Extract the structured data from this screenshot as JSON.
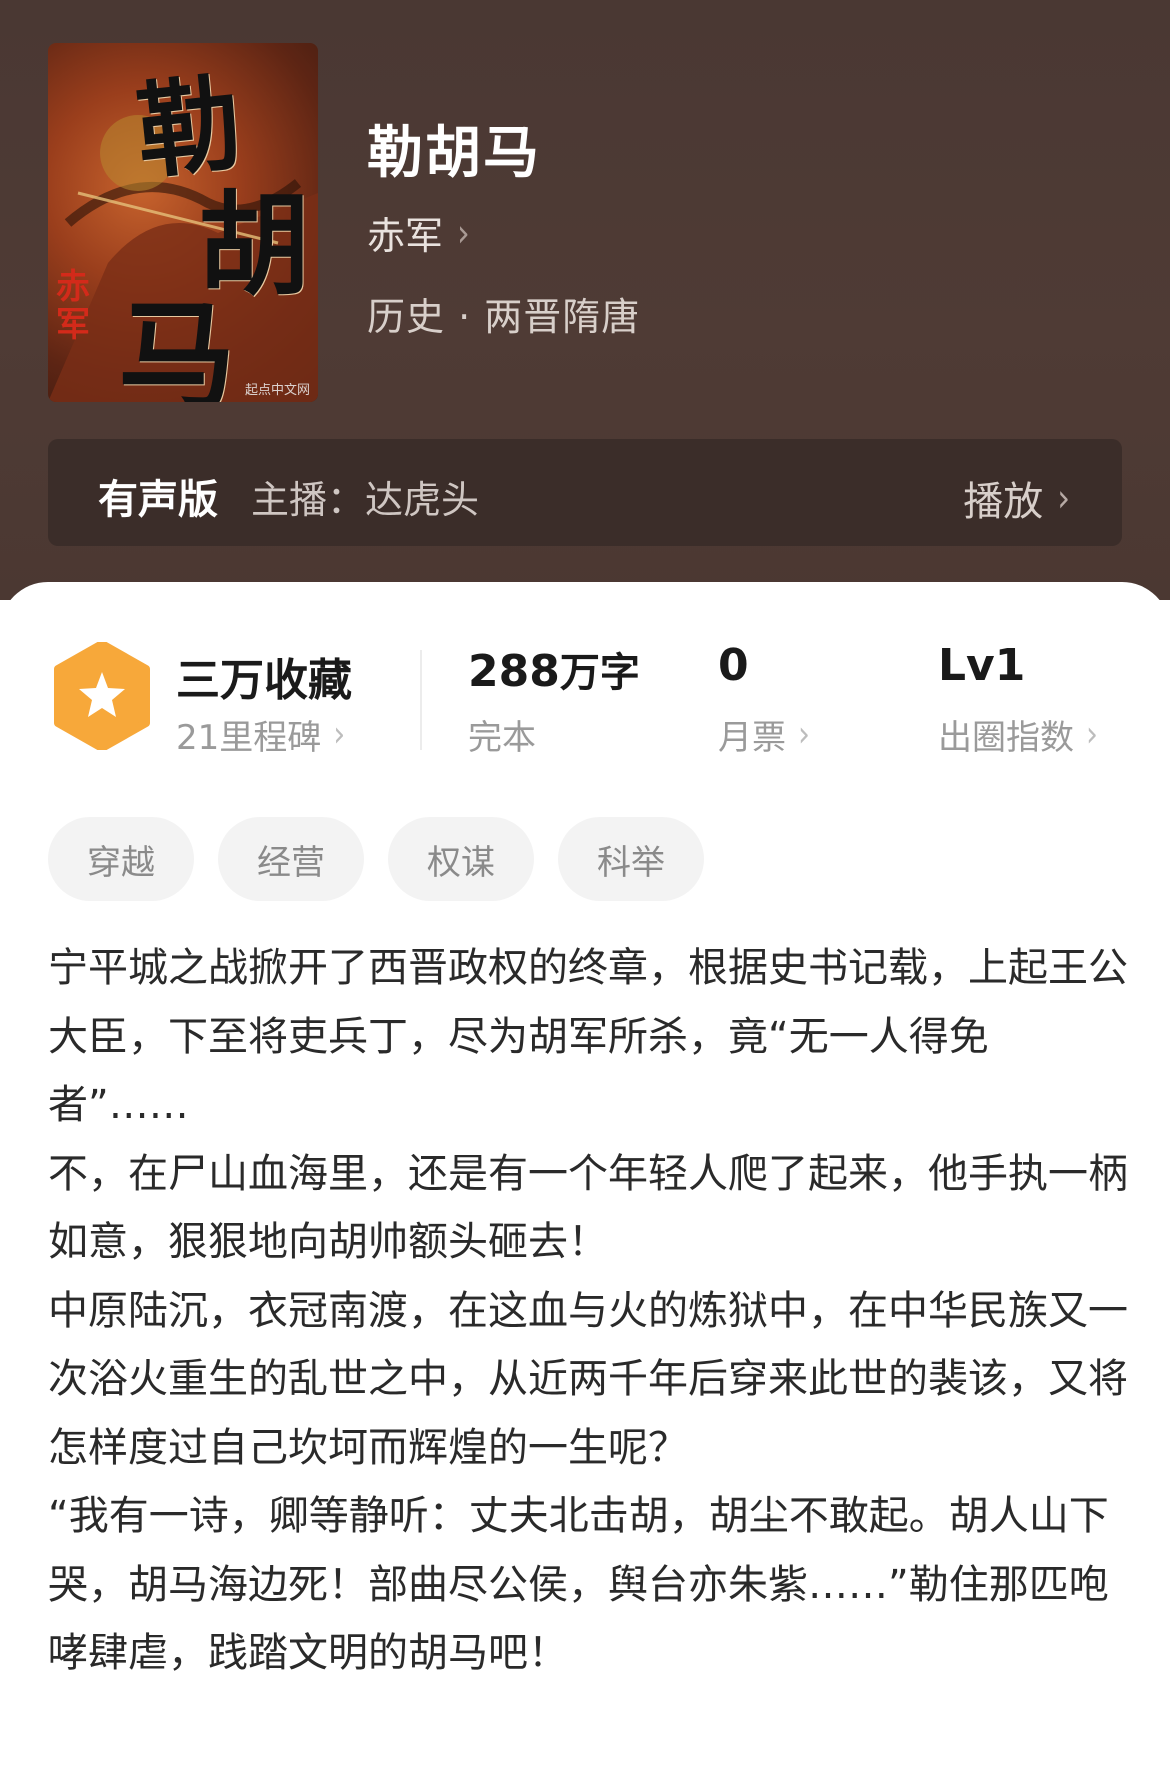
{
  "book": {
    "title": "勒胡马",
    "author": "赤军",
    "category": "历史 · 两晋隋唐",
    "cover": {
      "title_chars": [
        "勒",
        "胡",
        "马"
      ],
      "author_text": "赤军",
      "publisher_text": "起点中文网"
    }
  },
  "audio": {
    "label": "有声版",
    "host": "主播：达虎头",
    "play_label": "播放"
  },
  "stats": {
    "collect_main": "三万收藏",
    "collect_sub": "21里程碑",
    "words_value": "288",
    "words_unit": "万字",
    "words_sub": "完本",
    "ticket_value": "0",
    "ticket_sub": "月票",
    "level_value": "Lv1",
    "level_sub": "出圈指数"
  },
  "tags": [
    "穿越",
    "经营",
    "权谋",
    "科举"
  ],
  "description": [
    "宁平城之战掀开了西晋政权的终章，根据史书记载，上起王公大臣，下至将吏兵丁，尽为胡军所杀，竟“无一人得免者”……",
    "不，在尸山血海里，还是有一个年轻人爬了起来，他手执一柄如意，狠狠地向胡帅额头砸去！",
    "中原陆沉，衣冠南渡，在这血与火的炼狱中，在中华民族又一次浴火重生的乱世之中，从近两千年后穿来此世的裴该，又将怎样度过自己坎坷而辉煌的一生呢？",
    "“我有一诗，卿等静听：丈夫北击胡，胡尘不敢起。胡人山下哭，胡马海边死！部曲尽公侯，舆台亦朱紫……”勒住那匹咆哮肆虐，践踏文明的胡马吧！"
  ],
  "colors": {
    "header_bg": "#4e3a34",
    "audio_bg": "#3b2d29",
    "badge_orange": "#f7a83a",
    "text_dark": "#2a2a2a",
    "text_muted": "#9a9a9a"
  }
}
